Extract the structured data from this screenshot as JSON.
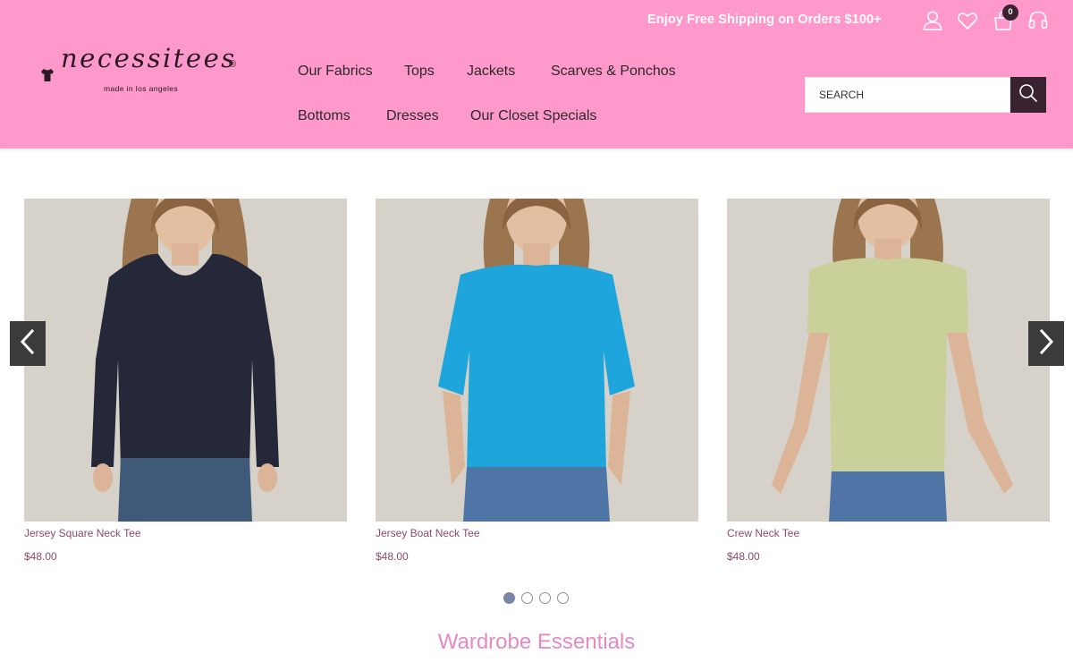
{
  "header": {
    "promo_text": "Enjoy Free Shipping on Orders $100+",
    "cart_count": "0",
    "logo": {
      "name": "necessitees",
      "registered": "®",
      "tagline": "made in los angeles"
    },
    "nav": [
      {
        "label": "Our Fabrics"
      },
      {
        "label": "Tops"
      },
      {
        "label": "Jackets"
      },
      {
        "label": "Scarves & Ponchos"
      },
      {
        "label": "Bottoms"
      },
      {
        "label": "Dresses"
      },
      {
        "label": "Our Closet Specials"
      }
    ],
    "search": {
      "placeholder": "SEARCH",
      "value": ""
    },
    "icons": [
      "user-icon",
      "heart-icon",
      "bag-icon",
      "headset-icon",
      "search-icon"
    ],
    "colors": {
      "header_bg": "#ff99cb",
      "search_button": "#3a2330"
    }
  },
  "carousel": {
    "products": [
      {
        "name": "Jersey Square Neck Tee",
        "price": "$48.00",
        "shirt_color": "#242838"
      },
      {
        "name": "Jersey Boat Neck Tee",
        "price": "$48.00",
        "shirt_color": "#1da5dc"
      },
      {
        "name": "Crew Neck Tee",
        "price": "$48.00",
        "shirt_color": "#c9d09a"
      }
    ],
    "page_count": 4,
    "active_page": 1,
    "icons": [
      "chevron-left-icon",
      "chevron-right-icon"
    ]
  },
  "section": {
    "title": "Wardrobe Essentials"
  }
}
